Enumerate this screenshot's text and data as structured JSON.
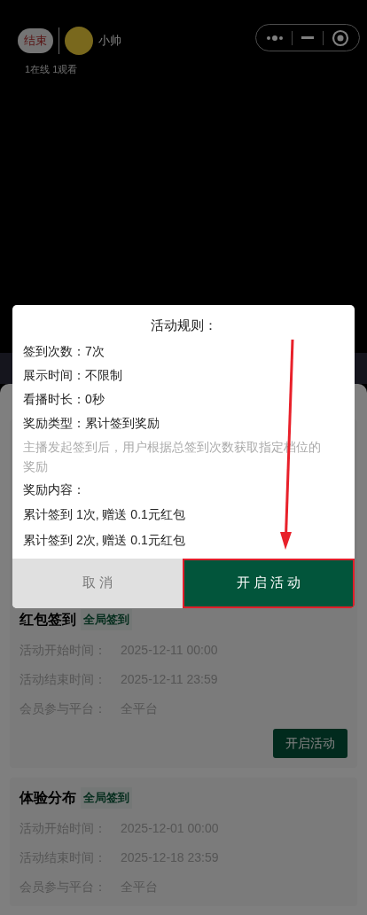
{
  "live_header": {
    "end_button": "结束",
    "host_name": "小帅",
    "stats": "1在线 1观看"
  },
  "dialog": {
    "title": "活动规则：",
    "rules": [
      {
        "kind": "line",
        "text": "签到次数：7次"
      },
      {
        "kind": "line",
        "text": "展示时间：不限制"
      },
      {
        "kind": "line",
        "text": "看播时长：0秒"
      },
      {
        "kind": "line",
        "text": "奖励类型：累计签到奖励"
      },
      {
        "kind": "hint",
        "text": "主播发起签到后，用户根据总签到次数获取指定档位的奖励"
      },
      {
        "kind": "line",
        "text": "奖励内容："
      },
      {
        "kind": "reward",
        "text": "累计签到 1次, 赠送 0.1元红包"
      },
      {
        "kind": "reward",
        "text": "累计签到 2次, 赠送 0.1元红包"
      }
    ],
    "cancel": "取 消",
    "confirm": "开 启 活 动"
  },
  "activities": [
    {
      "name": "红包签到",
      "tag": "全局签到",
      "fields": [
        {
          "label": "活动开始时间：",
          "value": "2025-12-11 00:00"
        },
        {
          "label": "活动结束时间：",
          "value": "2025-12-11 23:59"
        },
        {
          "label": "会员参与平台：",
          "value": "全平台"
        }
      ],
      "button": "开启活动"
    },
    {
      "name": "体验分布",
      "tag": "全局签到",
      "fields": [
        {
          "label": "活动开始时间：",
          "value": "2025-12-01 00:00"
        },
        {
          "label": "活动结束时间：",
          "value": "2025-12-18 23:59"
        },
        {
          "label": "会员参与平台：",
          "value": "全平台"
        }
      ]
    }
  ]
}
